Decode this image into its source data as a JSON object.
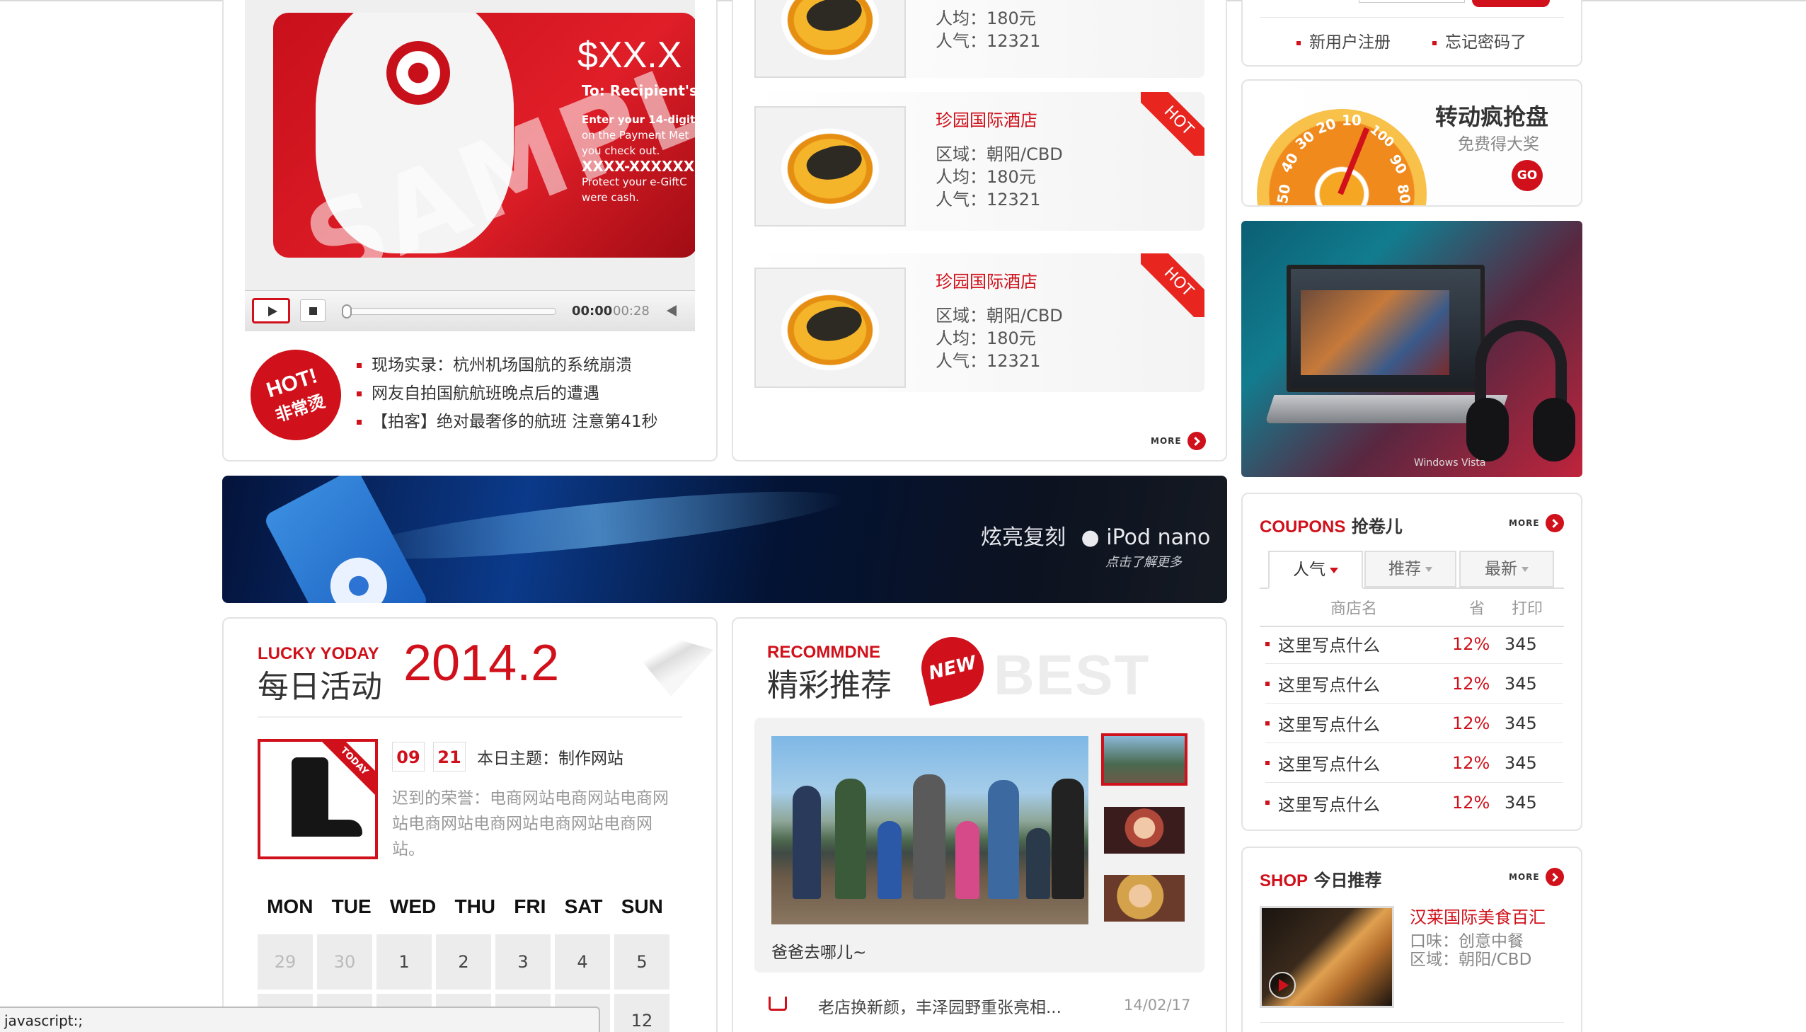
{
  "video": {
    "card_price": "$XX.X",
    "card_to": "To: Recipient's",
    "card_lines": [
      "Enter your 14-digit",
      "on the Payment Met",
      "you check out.",
      "XXXX-XXXXXX",
      "Protect your e-GiftC",
      "were cash."
    ],
    "watermark": "SAMPLE",
    "time_current": "00:00",
    "time_total": "00:28"
  },
  "hot_news": {
    "badge_line1": "HOT!",
    "badge_line2": "非常烫",
    "items": [
      "现场实录：杭州机场国航的系统崩溃",
      "网友自拍国航航班晚点后的遭遇",
      "【拍客】绝对最奢侈的航班 注意第41秒"
    ]
  },
  "restaurants": {
    "top_partial": {
      "per": "人均：180元",
      "pop": "人气：12321"
    },
    "items": [
      {
        "name": "珍园国际酒店",
        "area": "区域：朝阳/CBD",
        "per": "人均：180元",
        "pop": "人气：12321",
        "tag": "HOT"
      },
      {
        "name": "珍园国际酒店",
        "area": "区域：朝阳/CBD",
        "per": "人均：180元",
        "pop": "人气：12321",
        "tag": "HOT"
      }
    ],
    "more_label": "MORE"
  },
  "login": {
    "register": "新用户注册",
    "forgot": "忘记密码了"
  },
  "wheel": {
    "title": "转动疯抢盘",
    "subtitle": "免费得大奖",
    "go": "GO",
    "ticks": [
      "50",
      "40",
      "30",
      "20",
      "10",
      "100",
      "90",
      "80"
    ]
  },
  "laptop_ad": {
    "brand": "Windows Vista"
  },
  "ipod_banner": {
    "text": "炫亮复刻",
    "product": "iPod nano",
    "sub": "点击了解更多"
  },
  "daily": {
    "en": "LUCKY YODAY",
    "cn": "每日活动",
    "date": "2014.2",
    "today_tag": "TODAY",
    "month": "09",
    "day": "21",
    "theme": "本日主题：制作网站",
    "desc": "迟到的荣誉：电商网站电商网站电商网站电商网站电商网站电商网站电商网站。",
    "weekdays": [
      "MON",
      "TUE",
      "WED",
      "THU",
      "FRI",
      "SAT",
      "SUN"
    ],
    "row1": [
      "29",
      "30",
      "1",
      "2",
      "3",
      "4",
      "5"
    ],
    "row2_last": "12"
  },
  "recommend": {
    "en": "RECOMMDNE",
    "cn": "精彩推荐",
    "new_badge": "NEW",
    "best": "BEST",
    "caption": "爸爸去哪儿~",
    "news_text": "老店换新颜，丰泽园野重张亮相...",
    "news_date": "14/02/17"
  },
  "coupons": {
    "title_en": "COUPONS",
    "title_cn": "抢卷儿",
    "tabs": [
      "人气",
      "推荐",
      "最新"
    ],
    "headers": [
      "商店名",
      "省",
      "打印"
    ],
    "rows": [
      {
        "name": "这里写点什么",
        "save": "12%",
        "print": "345"
      },
      {
        "name": "这里写点什么",
        "save": "12%",
        "print": "345"
      },
      {
        "name": "这里写点什么",
        "save": "12%",
        "print": "345"
      },
      {
        "name": "这里写点什么",
        "save": "12%",
        "print": "345"
      },
      {
        "name": "这里写点什么",
        "save": "12%",
        "print": "345"
      }
    ],
    "more_label": "MORE"
  },
  "shop": {
    "title_en": "SHOP",
    "title_cn": "今日推荐",
    "name": "汉莱国际美食百汇",
    "taste": "口味：创意中餐",
    "area": "区域：朝阳/CBD",
    "more_label": "MORE"
  },
  "status_bar": {
    "text": "javascript:;"
  },
  "colors": {
    "accent": "#d0111b",
    "border": "#e3e3e3"
  }
}
